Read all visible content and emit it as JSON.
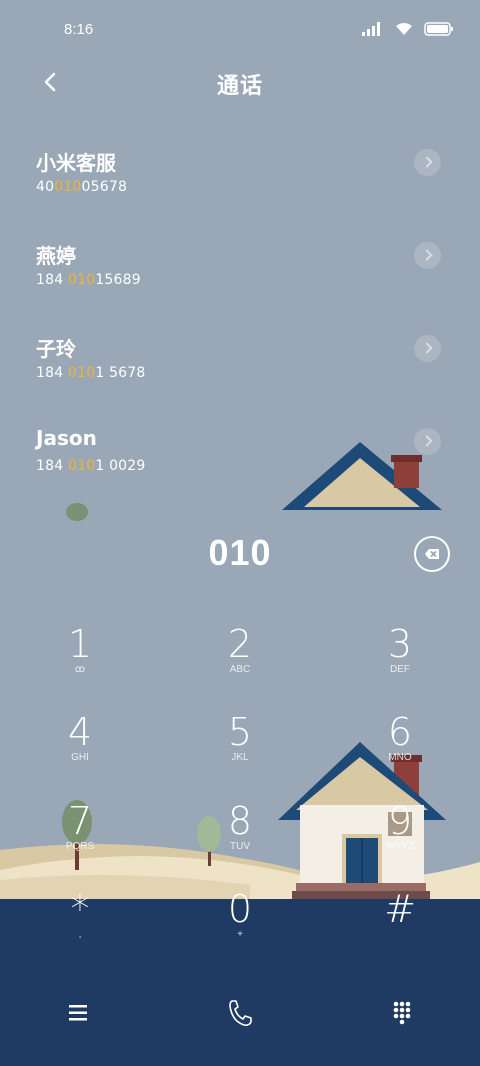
{
  "status": {
    "time": "8:16"
  },
  "header": {
    "title": "通话"
  },
  "contacts": [
    {
      "name": "小米客服",
      "num_pre": "40",
      "num_hl": "010",
      "num_post": "05678"
    },
    {
      "name": "燕婷",
      "num_pre": "184 ",
      "num_hl": "010",
      "num_post": "15689"
    },
    {
      "name": "子玲",
      "num_pre": "184 ",
      "num_hl": "010",
      "num_post": "1 5678"
    },
    {
      "name": "Jason",
      "num_pre": "184 ",
      "num_hl": "010",
      "num_post": "1 0029"
    }
  ],
  "dialed": "010",
  "keypad": [
    {
      "digit": "1",
      "letters": "ꝏ"
    },
    {
      "digit": "2",
      "letters": "ABC"
    },
    {
      "digit": "3",
      "letters": "DEF"
    },
    {
      "digit": "4",
      "letters": "GHI"
    },
    {
      "digit": "5",
      "letters": "JKL"
    },
    {
      "digit": "6",
      "letters": "MNO"
    },
    {
      "digit": "7",
      "letters": "PQRS"
    },
    {
      "digit": "8",
      "letters": "TUV"
    },
    {
      "digit": "9",
      "letters": "WXYZ"
    },
    {
      "digit": "*",
      "letters": ","
    },
    {
      "digit": "0",
      "letters": "+"
    },
    {
      "digit": "#",
      "letters": ""
    }
  ],
  "colors": {
    "background": "#9aa7b6",
    "highlight": "#f2b233",
    "bottom_bar": "#1f3a63",
    "roof": "#1e4a78"
  },
  "icons": {
    "back": "back-icon",
    "delete": "backspace-icon",
    "menu": "menu-icon",
    "call": "phone-icon",
    "dialpad": "dialpad-icon"
  }
}
